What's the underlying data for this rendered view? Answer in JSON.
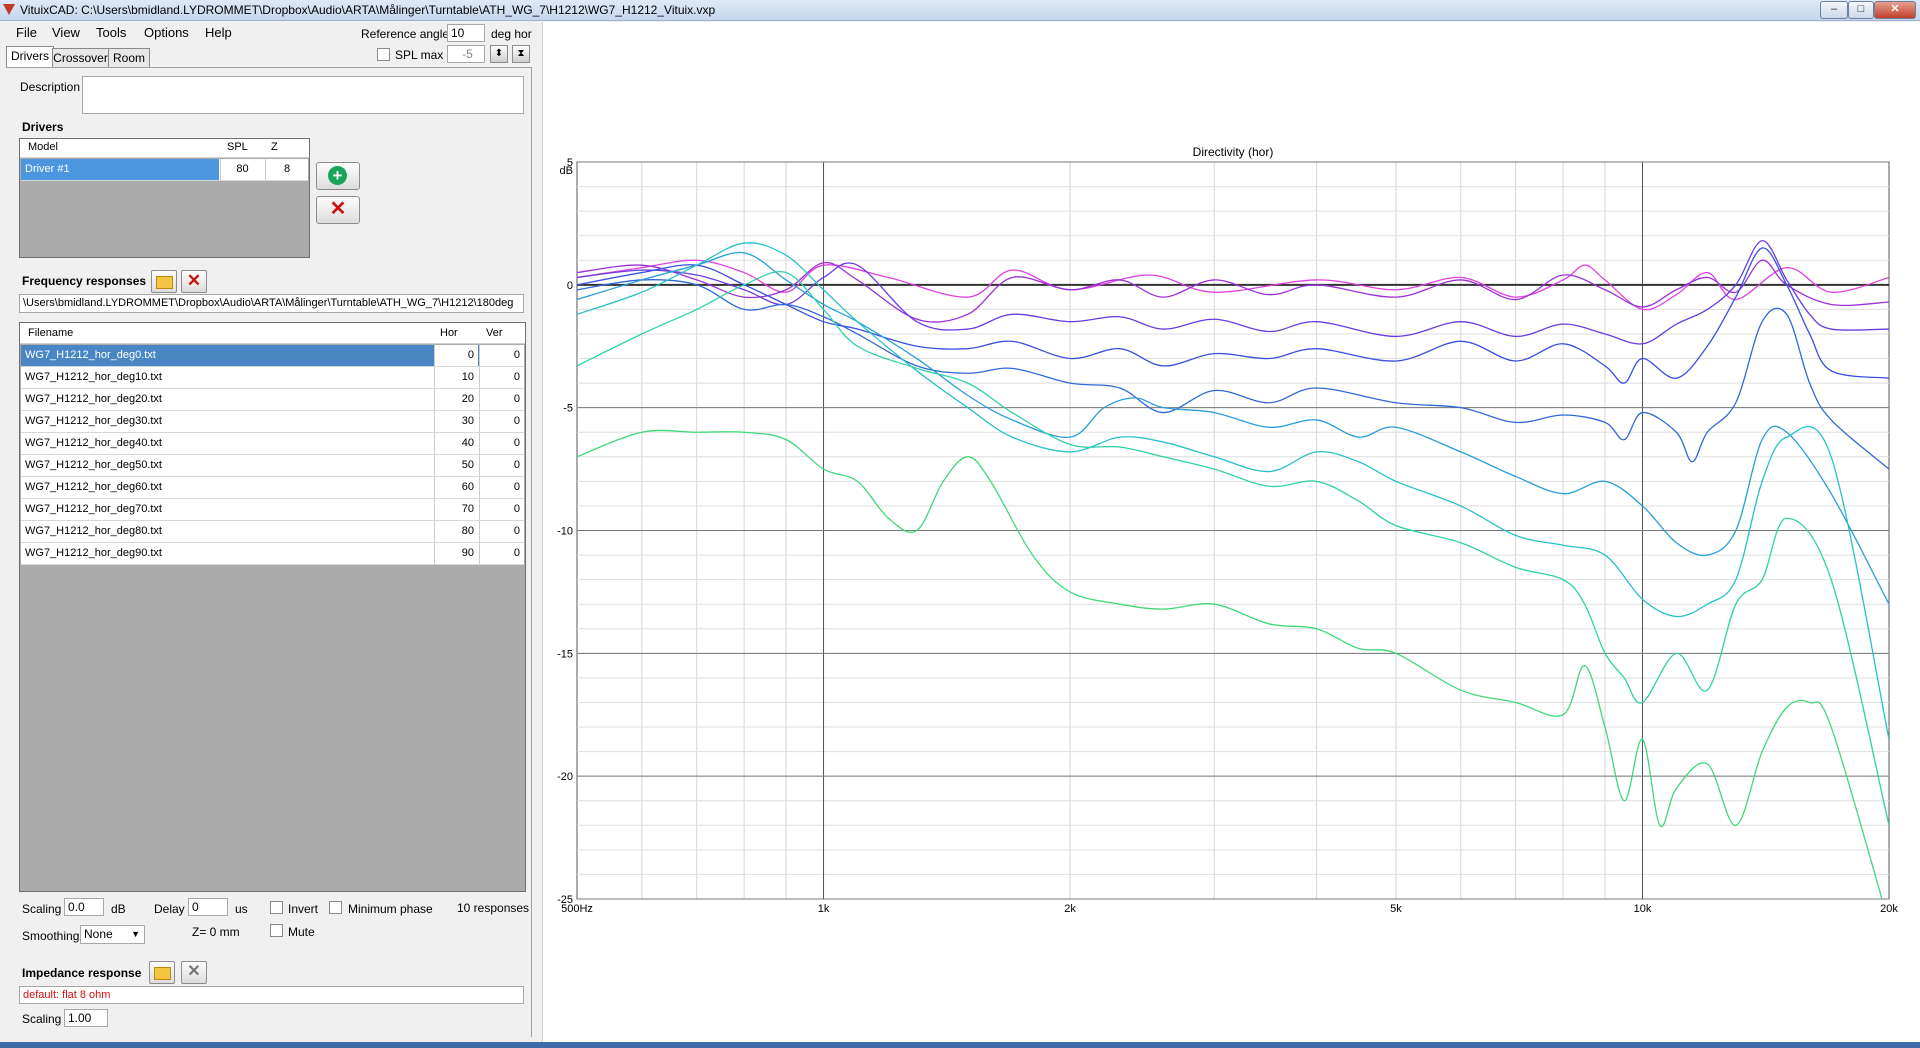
{
  "window": {
    "title": "VituixCAD: C:\\Users\\bmidland.LYDROMMET\\Dropbox\\Audio\\ARTA\\Målinger\\Turntable\\ATH_WG_7\\H1212\\WG7_H1212_Vituix.vxp",
    "minimize": "–",
    "maximize": "□",
    "close": "✕"
  },
  "menu": [
    "File",
    "View",
    "Tools",
    "Options",
    "Help"
  ],
  "toolbar": {
    "reference_angle_label": "Reference angle",
    "reference_angle_value": "10",
    "reference_angle_unit": "deg hor",
    "spl_max_label": "SPL max",
    "spl_max_value": "-5"
  },
  "tabs": [
    "Drivers",
    "Crossover",
    "Room"
  ],
  "description_label": "Description",
  "description_value": "",
  "drivers": {
    "section_title": "Drivers",
    "columns": [
      "Model",
      "SPL",
      "Z"
    ],
    "rows": [
      {
        "model": "Driver #1",
        "spl": "80",
        "z": "8"
      }
    ]
  },
  "frequency_responses": {
    "section_title": "Frequency responses",
    "path": "\\Users\\bmidland.LYDROMMET\\Dropbox\\Audio\\ARTA\\Målinger\\Turntable\\ATH_WG_7\\H1212\\180deg",
    "columns": [
      "Filename",
      "Hor",
      "Ver"
    ],
    "rows": [
      {
        "file": "WG7_H1212_hor_deg0.txt",
        "hor": "0",
        "ver": "0"
      },
      {
        "file": "WG7_H1212_hor_deg10.txt",
        "hor": "10",
        "ver": "0"
      },
      {
        "file": "WG7_H1212_hor_deg20.txt",
        "hor": "20",
        "ver": "0"
      },
      {
        "file": "WG7_H1212_hor_deg30.txt",
        "hor": "30",
        "ver": "0"
      },
      {
        "file": "WG7_H1212_hor_deg40.txt",
        "hor": "40",
        "ver": "0"
      },
      {
        "file": "WG7_H1212_hor_deg50.txt",
        "hor": "50",
        "ver": "0"
      },
      {
        "file": "WG7_H1212_hor_deg60.txt",
        "hor": "60",
        "ver": "0"
      },
      {
        "file": "WG7_H1212_hor_deg70.txt",
        "hor": "70",
        "ver": "0"
      },
      {
        "file": "WG7_H1212_hor_deg80.txt",
        "hor": "80",
        "ver": "0"
      },
      {
        "file": "WG7_H1212_hor_deg90.txt",
        "hor": "90",
        "ver": "0"
      }
    ],
    "scaling_label": "Scaling",
    "scaling_value": "0.0",
    "scaling_unit": "dB",
    "delay_label": "Delay",
    "delay_value": "0",
    "delay_unit": "us",
    "invert_label": "Invert",
    "minimum_phase_label": "Minimum phase",
    "count_text": "10 responses",
    "smoothing_label": "Smoothing",
    "smoothing_value": "None",
    "z_text": "Z= 0 mm",
    "mute_label": "Mute"
  },
  "impedance": {
    "section_title": "Impedance response",
    "value": "default: flat 8 ohm",
    "scaling_label": "Scaling",
    "scaling_value": "1.00"
  },
  "chart_data": {
    "type": "line",
    "title": "Directivity (hor)",
    "ylabel": "dB",
    "xscale": "log",
    "xlim": [
      500,
      20000
    ],
    "ylim": [
      -25,
      5
    ],
    "x_ticks": [
      {
        "v": 500,
        "label": "500Hz"
      },
      {
        "v": 1000,
        "label": "1k"
      },
      {
        "v": 2000,
        "label": "2k"
      },
      {
        "v": 5000,
        "label": "5k"
      },
      {
        "v": 10000,
        "label": "10k"
      },
      {
        "v": 20000,
        "label": "20k"
      }
    ],
    "y_ticks": [
      {
        "v": 5,
        "label": "5"
      },
      {
        "v": 0,
        "label": "0"
      },
      {
        "v": -5,
        "label": "-5"
      },
      {
        "v": -10,
        "label": "-10"
      },
      {
        "v": -15,
        "label": "-15"
      },
      {
        "v": -20,
        "label": "-20"
      },
      {
        "v": -25,
        "label": "-25"
      }
    ],
    "grid": true,
    "series": [
      {
        "color": "#333333",
        "x": [
          500,
          20000
        ],
        "y": [
          0,
          0
        ]
      },
      {
        "color": "#e040e0",
        "x": [
          500,
          600,
          700,
          800,
          900,
          1000,
          1200,
          1500,
          1700,
          2000,
          2500,
          3000,
          4000,
          5000,
          6000,
          7000,
          8000,
          8500,
          9000,
          10000,
          11000,
          12000,
          13000,
          15000,
          17000,
          20000
        ],
        "y": [
          0.3,
          0.7,
          1.0,
          0.5,
          -0.3,
          0.8,
          0.3,
          -0.5,
          0.6,
          -0.2,
          0.4,
          -0.3,
          0.2,
          -0.2,
          0.3,
          -0.5,
          0.2,
          0.8,
          0.2,
          -1.0,
          -0.4,
          0.5,
          -0.6,
          0.7,
          -0.3,
          0.3
        ]
      },
      {
        "color": "#9b30d8",
        "x": [
          500,
          600,
          700,
          800,
          900,
          1000,
          1100,
          1300,
          1500,
          1700,
          2000,
          2300,
          2600,
          3000,
          3500,
          4000,
          5000,
          6000,
          7000,
          8000,
          9000,
          10000,
          11000,
          12000,
          13000,
          14000,
          15000,
          17000,
          20000
        ],
        "y": [
          0.5,
          0.8,
          0.2,
          -0.5,
          -0.2,
          0.9,
          0.2,
          -1.4,
          -1.2,
          0.3,
          -0.2,
          0.2,
          -0.5,
          0.2,
          -0.4,
          0.0,
          -0.5,
          0.2,
          -0.6,
          0.4,
          -0.2,
          -0.9,
          -0.2,
          0.3,
          -0.3,
          1.0,
          0.0,
          -0.8,
          -0.7
        ]
      },
      {
        "color": "#6a3ce0",
        "x": [
          500,
          600,
          700,
          800,
          900,
          1000,
          1100,
          1300,
          1500,
          1700,
          2000,
          2300,
          2600,
          3000,
          3500,
          4000,
          5000,
          6000,
          7000,
          8000,
          9000,
          10000,
          11000,
          12000,
          13000,
          14000,
          15000,
          16000,
          17000,
          20000
        ],
        "y": [
          0.3,
          0.6,
          0.4,
          -0.2,
          -0.8,
          0.3,
          0.8,
          -1.5,
          -1.8,
          -1.2,
          -1.5,
          -1.3,
          -1.8,
          -1.4,
          -1.9,
          -1.5,
          -2.1,
          -1.5,
          -2.1,
          -1.6,
          -2.0,
          -2.4,
          -1.6,
          -1.0,
          0.0,
          1.8,
          0.2,
          -1.2,
          -1.8,
          -1.8
        ]
      },
      {
        "color": "#3a4fe0",
        "x": [
          500,
          600,
          700,
          800,
          900,
          1000,
          1100,
          1300,
          1500,
          1700,
          2000,
          2300,
          2600,
          3000,
          3500,
          4000,
          5000,
          6000,
          7000,
          8000,
          9000,
          9500,
          10000,
          11000,
          12000,
          13000,
          14000,
          15000,
          16000,
          17000,
          20000
        ],
        "y": [
          0.0,
          0.5,
          0.8,
          0.0,
          -0.8,
          -1.5,
          -1.8,
          -2.5,
          -2.6,
          -2.3,
          -3.0,
          -2.6,
          -3.3,
          -2.8,
          -3.0,
          -2.6,
          -3.1,
          -2.3,
          -3.1,
          -2.4,
          -3.3,
          -4.0,
          -3.0,
          -3.8,
          -2.5,
          -0.5,
          1.5,
          0.0,
          -2.0,
          -3.5,
          -3.8
        ]
      },
      {
        "color": "#3068d8",
        "x": [
          500,
          600,
          700,
          800,
          900,
          1000,
          1100,
          1300,
          1500,
          1700,
          2000,
          2300,
          2600,
          3000,
          3500,
          4000,
          5000,
          6000,
          7000,
          8000,
          9000,
          9500,
          10000,
          11000,
          11500,
          12000,
          13000,
          14000,
          15000,
          16000,
          17000,
          20000
        ],
        "y": [
          -0.2,
          0.2,
          0.0,
          -1.0,
          -0.8,
          -1.3,
          -2.0,
          -3.3,
          -3.6,
          -3.4,
          -4.0,
          -4.2,
          -5.2,
          -4.3,
          -4.8,
          -4.2,
          -4.8,
          -5.0,
          -5.6,
          -5.3,
          -5.6,
          -6.3,
          -5.2,
          -6.0,
          -7.2,
          -6.0,
          -4.8,
          -1.5,
          -1.2,
          -4.0,
          -5.5,
          -7.5
        ]
      },
      {
        "color": "#2a9ed8",
        "x": [
          500,
          600,
          700,
          800,
          900,
          1000,
          1100,
          1300,
          1500,
          1700,
          2000,
          2200,
          2400,
          2600,
          3000,
          3500,
          4000,
          4500,
          5000,
          6000,
          7000,
          8000,
          9000,
          10000,
          11000,
          12000,
          13000,
          14000,
          15000,
          17000,
          20000
        ],
        "y": [
          -0.6,
          0.2,
          0.8,
          1.3,
          0.2,
          -0.8,
          -1.5,
          -3.0,
          -4.5,
          -5.5,
          -6.2,
          -5.0,
          -4.6,
          -5.0,
          -5.2,
          -5.8,
          -5.5,
          -6.2,
          -5.8,
          -6.8,
          -7.8,
          -8.5,
          -8.0,
          -9.0,
          -10.5,
          -11.0,
          -10.0,
          -6.3,
          -6.0,
          -8.5,
          -13.0
        ]
      },
      {
        "color": "#28c0c8",
        "x": [
          500,
          600,
          700,
          800,
          900,
          1000,
          1100,
          1300,
          1500,
          1700,
          2000,
          2300,
          2600,
          3000,
          3500,
          4000,
          4500,
          5000,
          6000,
          7000,
          8000,
          9000,
          10000,
          11000,
          12000,
          13000,
          14000,
          15000,
          17000,
          20000
        ],
        "y": [
          -1.2,
          -0.3,
          0.8,
          1.7,
          1.2,
          -0.2,
          -1.5,
          -3.5,
          -5.0,
          -6.2,
          -6.8,
          -6.2,
          -6.4,
          -7.0,
          -7.6,
          -6.8,
          -7.2,
          -8.0,
          -9.0,
          -10.2,
          -10.6,
          -11.0,
          -12.8,
          -13.5,
          -13.0,
          -12.0,
          -8.0,
          -6.2,
          -7.0,
          -18.5
        ]
      },
      {
        "color": "#30d0a8",
        "x": [
          500,
          600,
          700,
          800,
          900,
          1000,
          1100,
          1300,
          1500,
          1700,
          2000,
          2300,
          2600,
          3000,
          3500,
          4000,
          4500,
          5000,
          6000,
          7000,
          8000,
          8500,
          9000,
          9500,
          10000,
          11000,
          12000,
          13000,
          14000,
          15000,
          17000,
          20000
        ],
        "y": [
          -3.3,
          -2.0,
          -1.0,
          0.0,
          0.5,
          -1.0,
          -2.5,
          -3.4,
          -4.0,
          -5.2,
          -6.5,
          -6.6,
          -7.0,
          -7.5,
          -8.2,
          -8.0,
          -8.8,
          -9.8,
          -10.5,
          -11.5,
          -12.0,
          -13.0,
          -15.0,
          -16.0,
          -17.0,
          -15.0,
          -16.5,
          -13.0,
          -12.0,
          -9.5,
          -12.0,
          -22.0
        ]
      },
      {
        "color": "#40d878",
        "x": [
          500,
          600,
          700,
          800,
          900,
          1000,
          1100,
          1200,
          1300,
          1400,
          1500,
          1600,
          1800,
          2000,
          2300,
          2600,
          3000,
          3500,
          4000,
          4500,
          5000,
          6000,
          7000,
          8000,
          8500,
          9000,
          9500,
          10000,
          10500,
          11000,
          12000,
          13000,
          14000,
          15000,
          16000,
          17000,
          20000
        ],
        "y": [
          -7.0,
          -6.0,
          -6.0,
          -6.0,
          -6.3,
          -7.5,
          -8.0,
          -9.5,
          -10.0,
          -8.0,
          -7.0,
          -8.0,
          -11.0,
          -12.5,
          -13.0,
          -13.2,
          -13.0,
          -13.8,
          -14.0,
          -14.8,
          -15.0,
          -16.5,
          -17.0,
          -17.5,
          -15.5,
          -18.0,
          -21.0,
          -18.5,
          -22.0,
          -20.5,
          -19.5,
          -22.0,
          -19.0,
          -17.2,
          -17.0,
          -18.0,
          -26.0
        ]
      }
    ]
  }
}
